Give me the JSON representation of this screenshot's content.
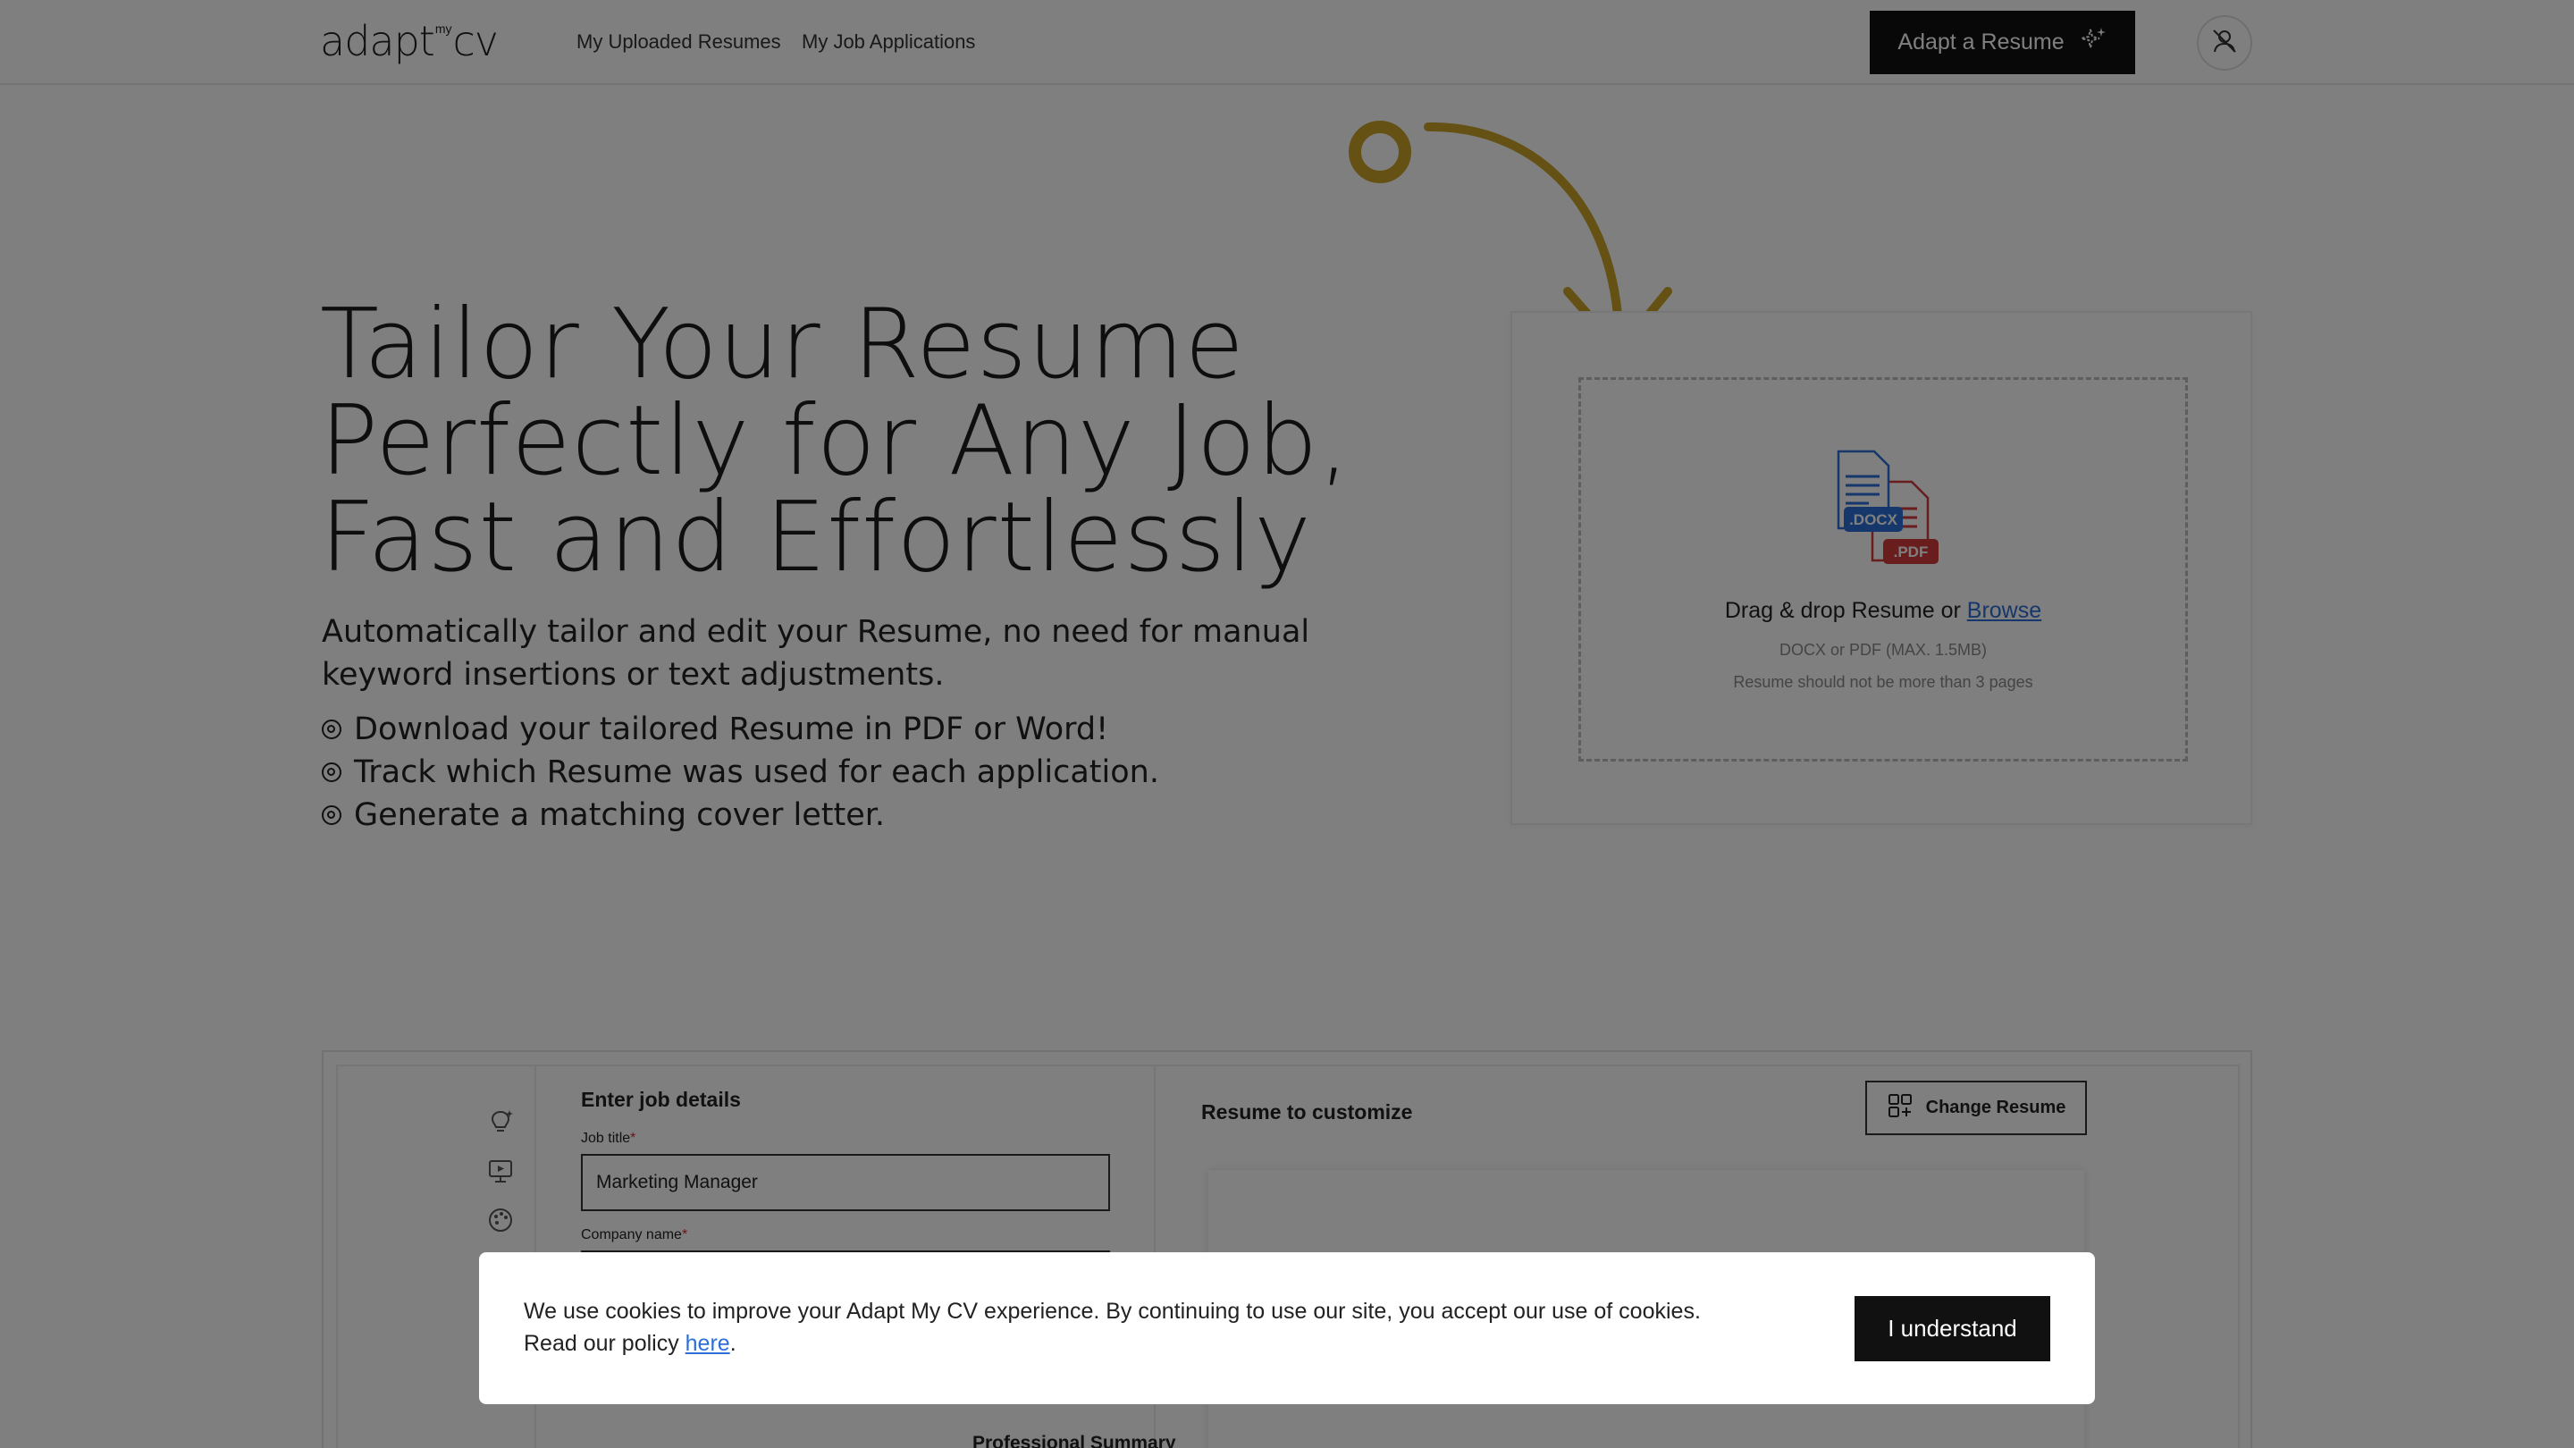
{
  "header": {
    "logo_main": "adapt",
    "logo_my": "my",
    "logo_end": "cv",
    "nav": [
      "My Uploaded Resumes",
      "My Job Applications"
    ],
    "cta_label": "Adapt a Resume"
  },
  "hero": {
    "title_lines": [
      "Tailor Your Resume",
      "Perfectly for Any Job,",
      "Fast and Effortlessly"
    ],
    "subtitle": "Automatically tailor and edit your Resume, no need for manual keyword insertions or text adjustments.",
    "features": [
      "Download your tailored Resume in PDF or Word!",
      "Track which Resume was used for each application.",
      "Generate a matching cover letter."
    ]
  },
  "upload": {
    "docx_badge": ".DOCX",
    "pdf_badge": ".PDF",
    "drop_text": "Drag & drop Resume or ",
    "browse_label": "Browse",
    "formats_hint": "DOCX or PDF (MAX. 1.5MB)",
    "pages_hint": "Resume should not be more than 3 pages"
  },
  "demo": {
    "form_heading": "Enter job details",
    "job_title_label": "Job title",
    "job_title_value": "Marketing Manager",
    "company_label": "Company name",
    "required_mark": "*",
    "resume_heading": "Resume to customize",
    "change_resume_label": "Change Resume",
    "section_heading": "Professional Summary"
  },
  "cookie": {
    "line1": "We use cookies to improve your Adapt My CV experience. By continuing to use our site, you accept our use of cookies.",
    "line2_prefix": "Read our policy ",
    "link_label": "here",
    "line2_suffix": ".",
    "button_label": "I understand"
  },
  "colors": {
    "accent_arrow": "#c9a227",
    "docx_blue": "#2d6fd6",
    "pdf_red": "#d23a3a",
    "link_blue": "#2d6fd6",
    "button_dark": "#111111"
  }
}
